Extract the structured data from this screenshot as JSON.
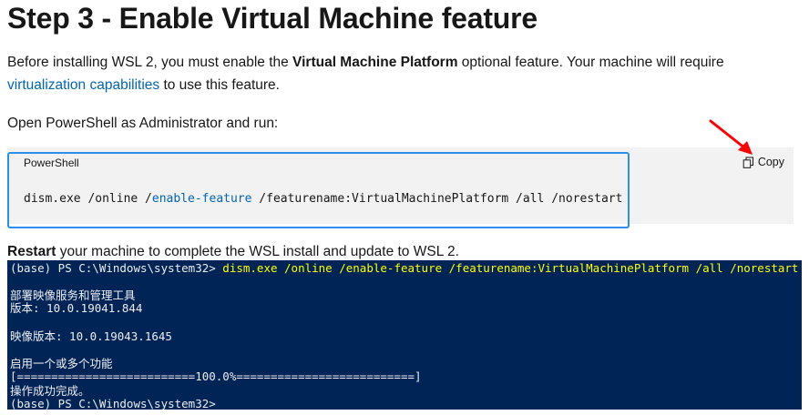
{
  "heading": "Step 3 - Enable Virtual Machine feature",
  "intro": {
    "part1": "Before installing WSL 2, you must enable the ",
    "bold": "Virtual Machine Platform",
    "part2": " optional feature. Your machine will require ",
    "link": "virtualization capabilities",
    "part3": " to use this feature."
  },
  "open_powershell": "Open PowerShell as Administrator and run:",
  "code_block": {
    "language": "PowerShell",
    "copy_label": "Copy",
    "command_pre": "dism.exe /online /",
    "command_keyword": "enable-feature",
    "command_post": " /featurename:VirtualMachinePlatform /all /norestart"
  },
  "restart": {
    "bold": "Restart",
    "rest": " your machine to complete the WSL install and update to WSL 2."
  },
  "terminal": {
    "prompt": "(base) PS C:\\Windows\\system32> ",
    "command": "dism.exe /online /enable-feature /featurename:VirtualMachinePlatform /all /norestart",
    "tool_name": "部署映像服务和管理工具",
    "version": "版本: 10.0.19041.844",
    "image_version": "映像版本: 10.0.19043.1645",
    "enabling": "启用一个或多个功能",
    "progress": "[==========================100.0%==========================]",
    "success": "操作成功完成。",
    "final_prompt": "(base) PS C:\\Windows\\system32>"
  },
  "colors": {
    "link": "#0065b3",
    "highlight_border": "#2b8ff0",
    "annotation_arrow": "#ff0000",
    "terminal_bg": "#012456",
    "terminal_command": "#ffff00"
  }
}
